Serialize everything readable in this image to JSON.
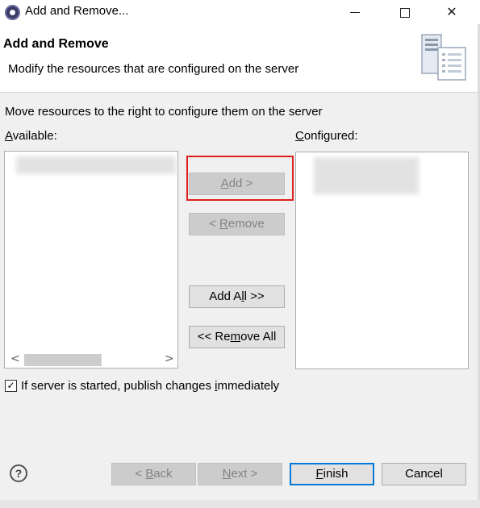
{
  "window": {
    "title": "Add and Remove...",
    "minimize": "–",
    "maximize": "□",
    "close": "✕"
  },
  "header": {
    "title": "Add and Remove",
    "description": "Modify the resources that are configured on the server",
    "icon": "server-config-icon"
  },
  "instruction": "Move resources to the right to configure them on the server",
  "available": {
    "label_mnemonic": "A",
    "label_rest": "vailable:",
    "scroll_left": "<",
    "scroll_right": ">"
  },
  "configured": {
    "label_mnemonic": "C",
    "label_rest": "onfigured:"
  },
  "buttons": {
    "add": {
      "pre": "",
      "mnemonic": "A",
      "post": "dd >"
    },
    "remove": {
      "pre": "< ",
      "mnemonic": "R",
      "post": "emove"
    },
    "add_all": {
      "pre": "Add A",
      "mnemonic": "l",
      "post": "l >>"
    },
    "remove_all": {
      "pre": "<< Re",
      "mnemonic": "m",
      "post": "ove All"
    },
    "back": {
      "pre": "< ",
      "mnemonic": "B",
      "post": "ack"
    },
    "next": {
      "pre": "",
      "mnemonic": "N",
      "post": "ext >"
    },
    "finish": {
      "pre": "",
      "mnemonic": "F",
      "post": "inish"
    },
    "cancel": "Cancel"
  },
  "publish_option": {
    "checked": true,
    "check_mark": "✓",
    "pre": "If server is started, publish changes ",
    "mnemonic": "i",
    "post": "mmediately"
  },
  "help": {
    "glyph": "?"
  },
  "colors": {
    "highlight": "#e02020",
    "default_button_border": "#0078d7"
  }
}
